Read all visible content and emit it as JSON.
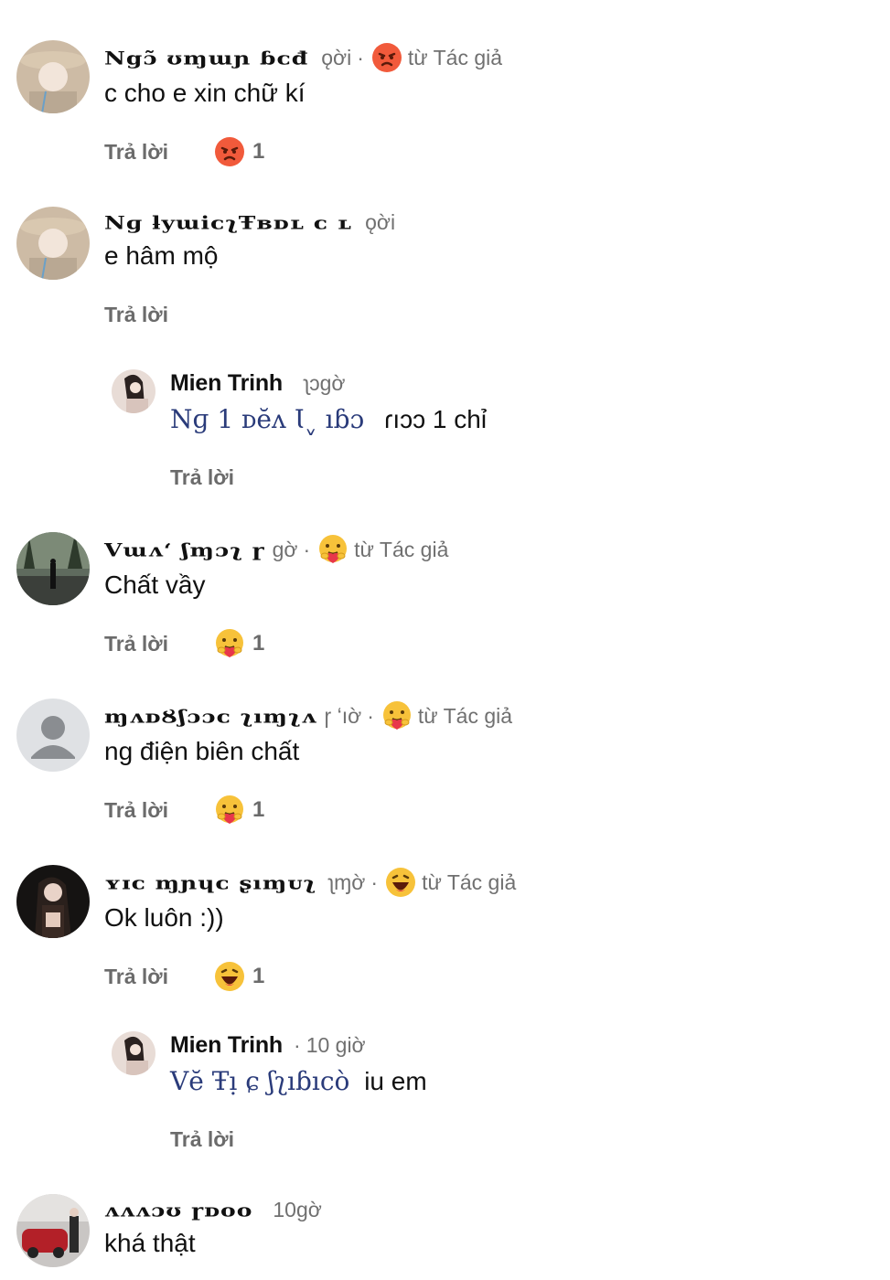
{
  "comments": [
    {
      "name": "Ngɔ̃ ʊɱɯɲ ɓᴄđ",
      "time": "ǫời",
      "author_reaction": "từ Tác giả",
      "text": "c cho e xin chữ kí",
      "reply_label": "Trả lời",
      "reaction_count": "1",
      "reaction": "angry"
    },
    {
      "name": "Nɡ ƚyɯiᴄʅŦʙᴅʟ   ᴄ ʟ",
      "time": "ǫời",
      "text": "e hâm mộ",
      "reply_label": "Trả lời"
    },
    {
      "name": "Mien Trinh",
      "time": "ʅɔgờ",
      "mention": "Nɡ 1 ᴅĕʌ   Ɩˬ   ıɓɔ",
      "text_after": "ɾıɔɔ 1 chỉ",
      "reply_label": "Trả lời"
    },
    {
      "name": "Vɯʌʻ ʃɱɔʅ ɼ",
      "time": "ɡờ",
      "author_reaction": "từ Tác giả",
      "text": "Chất vầy",
      "reply_label": "Trả lời",
      "reaction_count": "1",
      "reaction": "care"
    },
    {
      "name": "ɱʌᴅȢʃɔɔᴄ ʅıɱʅʌ",
      "time": "ɼ ʻıờ",
      "author_reaction": "từ Tác giả",
      "text": "ng điện biên chất",
      "reply_label": "Trả lời",
      "reaction_count": "1",
      "reaction": "care"
    },
    {
      "name": "ʏɪᴄ  ɱɲɥᴄ  ʂıɱᴜʅ",
      "time": "ʅɱờ",
      "author_reaction": "từ Tác giả",
      "text": "Ok luôn :))",
      "reply_label": "Trả lời",
      "reaction_count": "1",
      "reaction": "haha"
    },
    {
      "name": "Mien Trinh",
      "time": "10 giờ",
      "mention": "Vĕ Ŧı̣ ɕ ʃʅıɓıcò",
      "text_after": "iu em",
      "reply_label": "Trả lời"
    },
    {
      "name": "ʌʌʌɔʊ ɼᴅᴏᴏ",
      "time": "10gờ",
      "text": "khá thật"
    }
  ],
  "colors": {
    "angry": "#f15a3b",
    "care": "#f7c23a",
    "haha": "#f7c23a",
    "mention": "#2a3b7a"
  }
}
